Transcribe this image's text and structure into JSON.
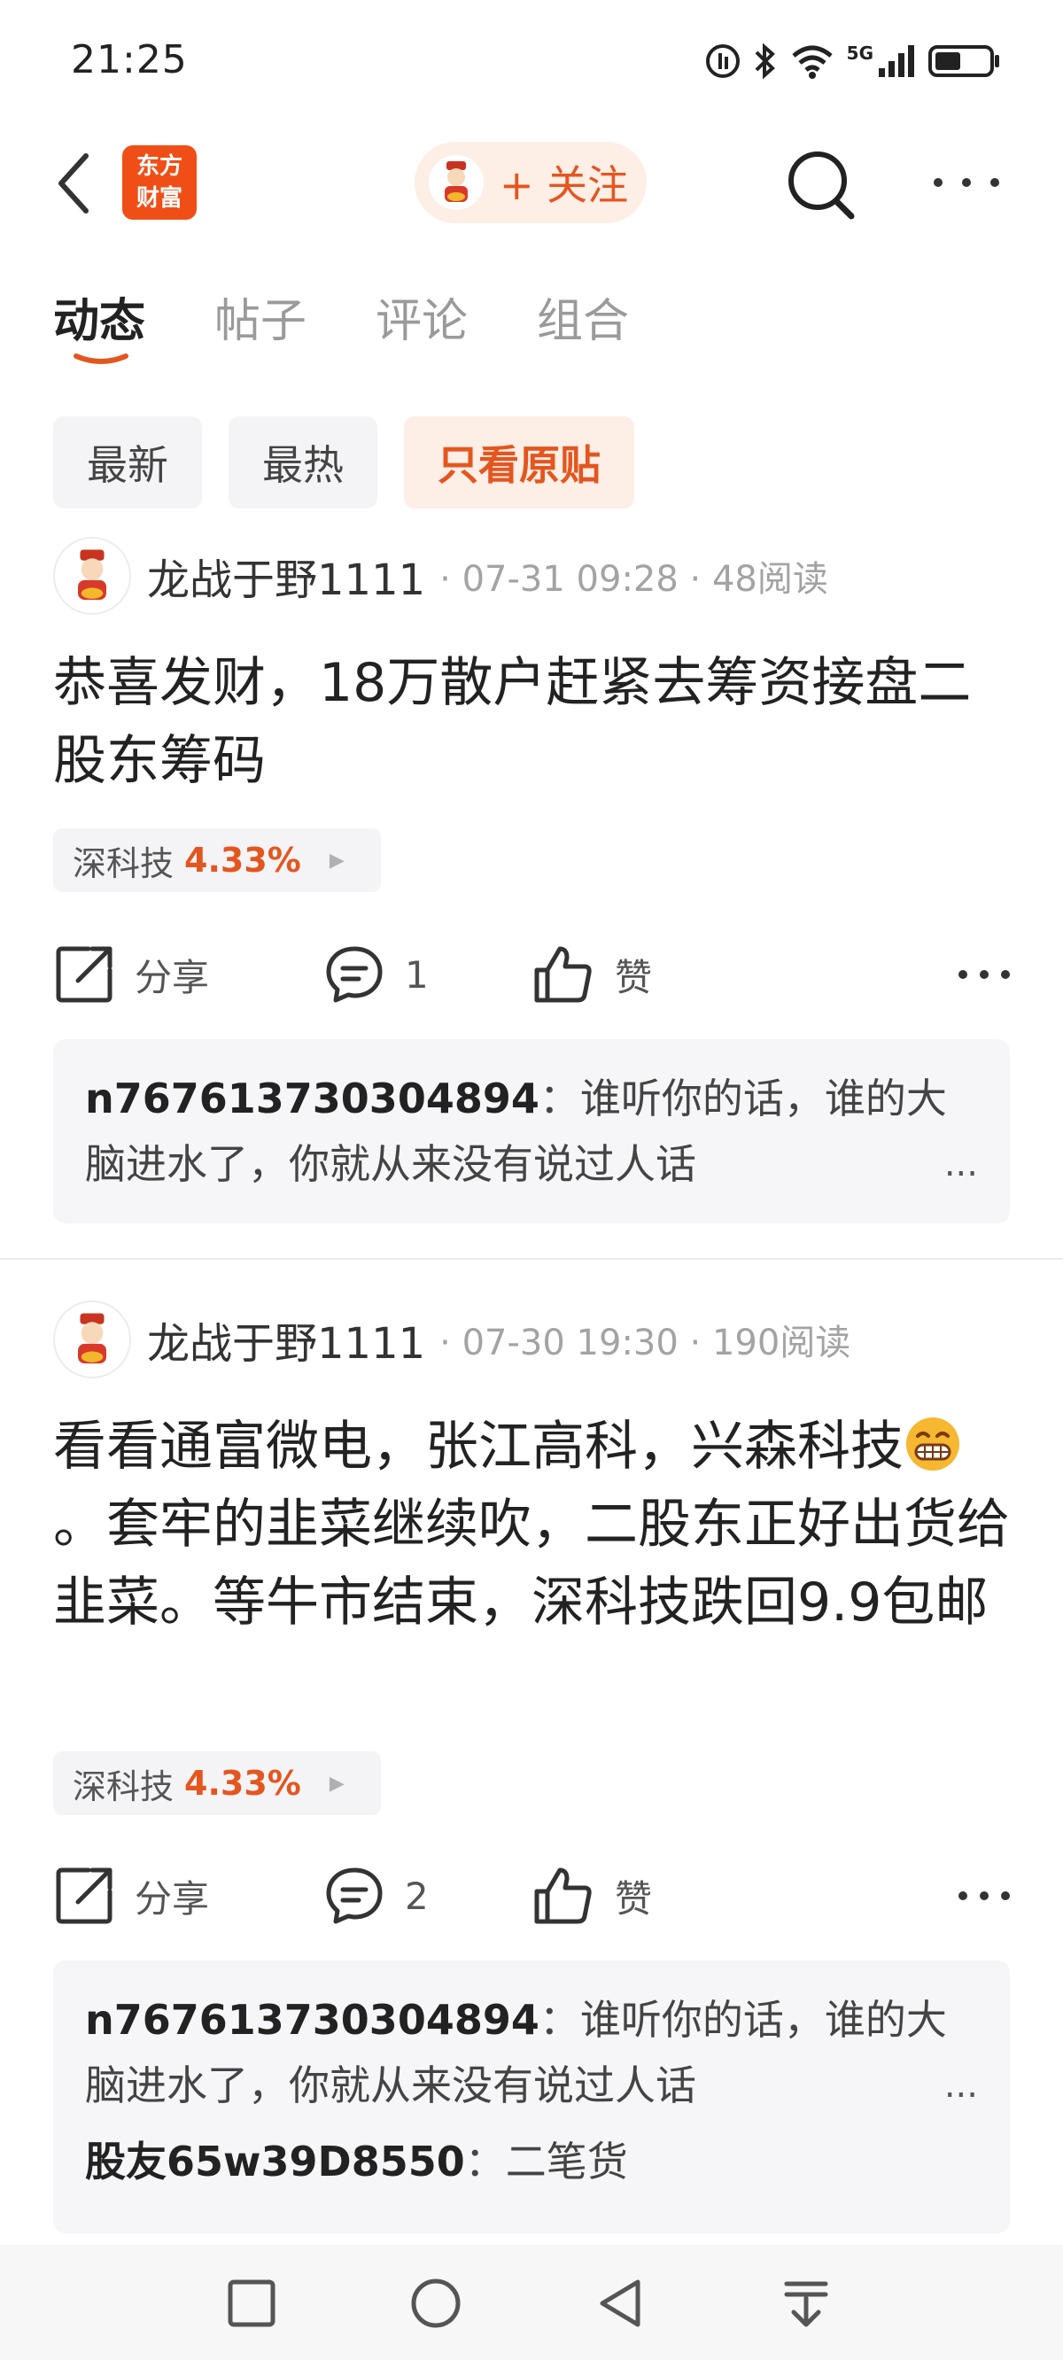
{
  "status": {
    "time": "21:25",
    "network": "5G"
  },
  "header": {
    "logo_line1": "东方",
    "logo_line2": "财富",
    "follow_label": "+ 关注"
  },
  "tabs": [
    {
      "label": "动态",
      "active": true
    },
    {
      "label": "帖子",
      "active": false
    },
    {
      "label": "评论",
      "active": false
    },
    {
      "label": "组合",
      "active": false
    }
  ],
  "filters": [
    {
      "label": "最新",
      "active": false
    },
    {
      "label": "最热",
      "active": false
    },
    {
      "label": "只看原贴",
      "active": true
    }
  ],
  "posts": [
    {
      "author": "龙战于野1111",
      "meta": "· 07-31 09:28 · 48阅读",
      "text": "恭喜发财，18万散户赶紧去筹资接盘二股东筹码",
      "stock_name": "深科技",
      "stock_change": "4.33%",
      "share_label": "分享",
      "comment_count": "1",
      "like_label": "赞",
      "comments": [
        {
          "user": "n767613730304894",
          "sep": "：",
          "text": "谁听你的话，谁的大脑进水了，你就从来没有说过人话",
          "ellipsis": "..."
        }
      ]
    },
    {
      "author": "龙战于野1111",
      "meta": "· 07-30 19:30 · 190阅读",
      "text_before_emoji": "看看通富微电，张江高科，兴森科技",
      "text_after_emoji": "。套牢的韭菜继续吹，二股东正好出货给韭菜。等牛市结束，深科技跌回9.9包邮",
      "stock_name": "深科技",
      "stock_change": "4.33%",
      "share_label": "分享",
      "comment_count": "2",
      "like_label": "赞",
      "comments": [
        {
          "user": "n767613730304894",
          "sep": "：",
          "text": "谁听你的话，谁的大脑进水了，你就从来没有说过人话",
          "ellipsis": "..."
        },
        {
          "user": "股友65w39D8550",
          "sep": "：",
          "text": "二笔货"
        }
      ]
    }
  ],
  "colors": {
    "accent": "#e4561f",
    "brand": "#ef4f17",
    "chip_bg": "#f4f4f6"
  }
}
